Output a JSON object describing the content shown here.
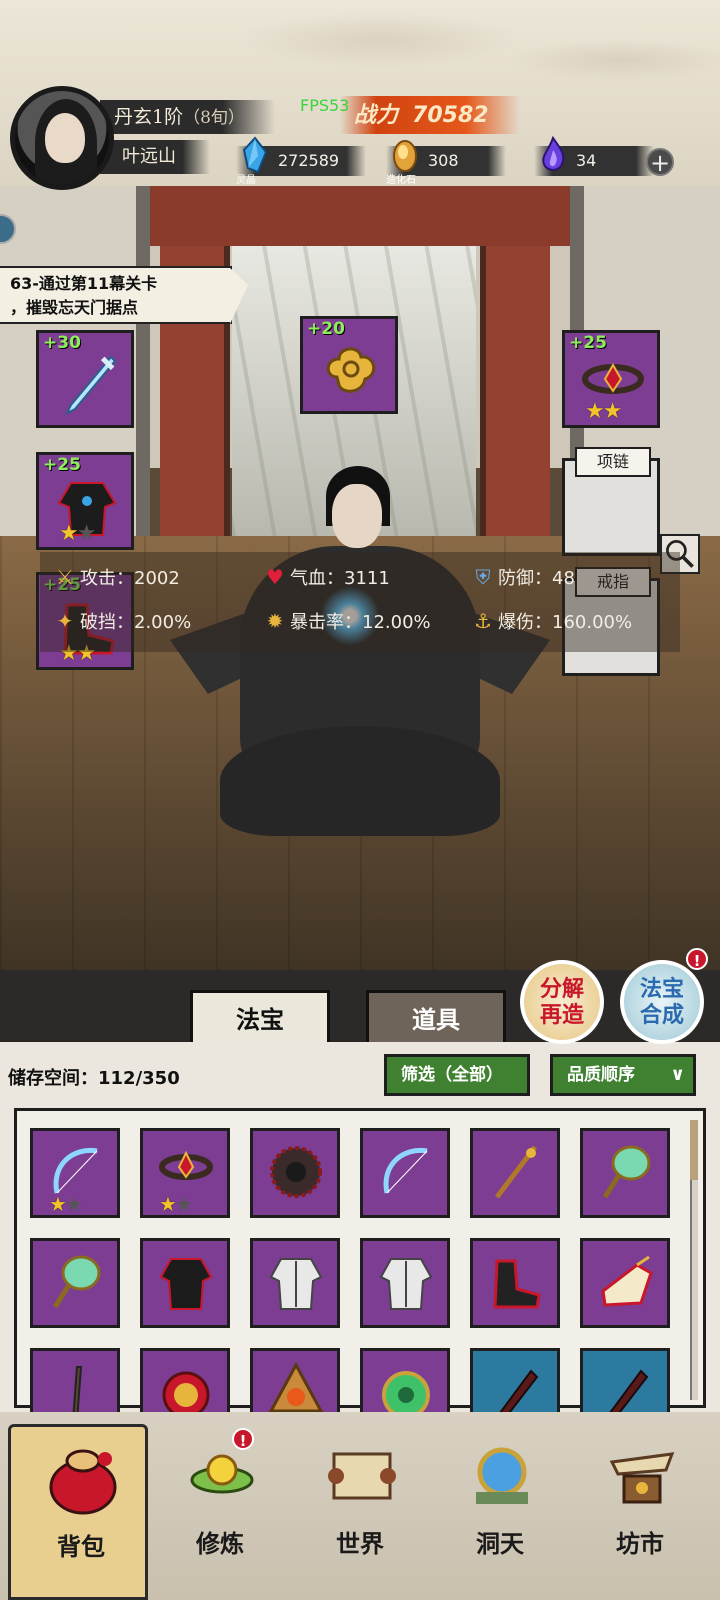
{
  "player": {
    "rank": "丹玄1阶",
    "rank_sub": "（8旬）",
    "name": "叶远山",
    "fps": "FPS53",
    "power_label": "战力",
    "power": "70582"
  },
  "currencies": [
    {
      "icon": "spirit-crystal-icon",
      "amount": "272589",
      "caption": "灵晶"
    },
    {
      "icon": "creation-stone-icon",
      "amount": "308",
      "caption": "造化石"
    },
    {
      "icon": "purple-flame-icon",
      "amount": "34",
      "caption": ""
    }
  ],
  "add_symbol": "+",
  "quest": {
    "line1": "63-通过第11幕关卡",
    "line2": "，摧毁忘天门据点"
  },
  "equipment": {
    "weapon": {
      "level": "+30",
      "icon": "sword-icon"
    },
    "talisman": {
      "level": "+20",
      "icon": "golden-cloud-icon"
    },
    "armor": {
      "level": "+25",
      "icon": "robe-icon",
      "stars": 1,
      "max_stars": 2
    },
    "boots": {
      "level": "+25",
      "icon": "boots-icon",
      "stars": 2,
      "max_stars": 2
    },
    "headband": {
      "level": "+25",
      "icon": "headband-icon",
      "stars": 2,
      "max_stars": 2
    },
    "necklace_label": "项链",
    "ring_label": "戒指"
  },
  "stats": {
    "attack": "攻击：2002",
    "hp": "气血：3111",
    "defense": "防御：48",
    "break": "破挡：2.00%",
    "crit_rate": "暴击率：12.00%",
    "crit_dmg": "爆伤：160.00%"
  },
  "actions": {
    "dismantle": "分解再造",
    "dismantle_l1": "分解",
    "dismantle_l2": "再造",
    "synth_l1": "法宝",
    "synth_l2": "合成",
    "badge": "!"
  },
  "tabs": {
    "treasure": "法宝",
    "items": "道具"
  },
  "inventory": {
    "storage": "储存空间：112/350",
    "filter": "筛选（全部）",
    "sort": "品质顺序",
    "items": [
      {
        "icon": "bow-icon",
        "stars": 1,
        "max_stars": 2
      },
      {
        "icon": "headband-icon",
        "stars": 1,
        "max_stars": 2
      },
      {
        "icon": "dark-wheel-icon"
      },
      {
        "icon": "bow-icon"
      },
      {
        "icon": "staff-icon"
      },
      {
        "icon": "jade-mirror-icon"
      },
      {
        "icon": "jade-mirror-icon"
      },
      {
        "icon": "robe-icon"
      },
      {
        "icon": "white-robe-icon"
      },
      {
        "icon": "white-robe-icon"
      },
      {
        "icon": "boots-icon"
      },
      {
        "icon": "golden-boots-icon"
      },
      {
        "icon": "whip-icon"
      },
      {
        "icon": "lion-helm-icon"
      },
      {
        "icon": "flame-medallion-icon"
      },
      {
        "icon": "jade-orb-icon"
      },
      {
        "icon": "blood-sword-icon",
        "blue": true
      },
      {
        "icon": "blood-sword-icon",
        "blue": true
      }
    ]
  },
  "nav": [
    {
      "label": "背包",
      "icon": "backpack-icon",
      "active": true
    },
    {
      "label": "修炼",
      "icon": "lotus-icon",
      "badge": "!"
    },
    {
      "label": "世界",
      "icon": "map-scroll-icon"
    },
    {
      "label": "洞天",
      "icon": "portal-icon"
    },
    {
      "label": "坊市",
      "icon": "market-icon"
    }
  ],
  "colors": {
    "rare_purple": "#7c3d92",
    "epic_blue": "#2d7aa0",
    "level_green": "#8dee5a",
    "power_orange": "#e5581a",
    "filter_green": "#3f8131",
    "alert_red": "#c8162b"
  }
}
